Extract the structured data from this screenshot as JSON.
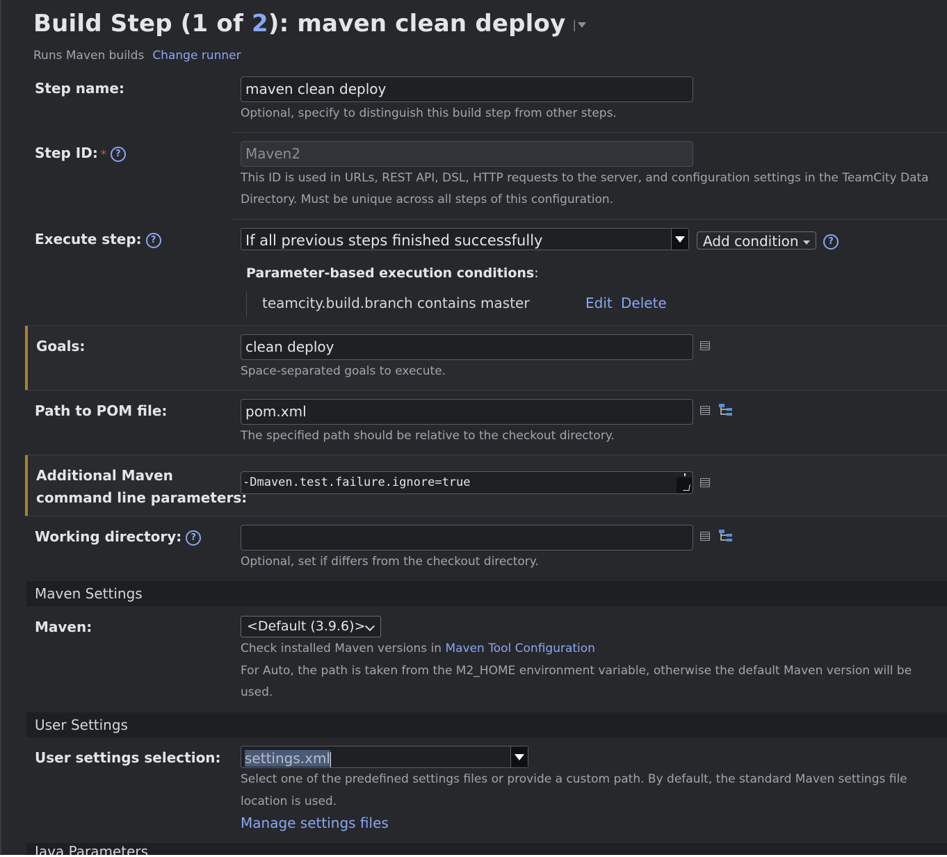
{
  "header": {
    "title_prefix": "Build Step (1 of ",
    "title_total": "2",
    "title_suffix": "): maven clean deploy",
    "runner_text": "Runs Maven builds",
    "change_runner_link": "Change runner"
  },
  "step_name": {
    "label": "Step name:",
    "value": "maven clean deploy",
    "hint": "Optional, specify to distinguish this build step from other steps."
  },
  "step_id": {
    "label": "Step ID:",
    "required_mark": "*",
    "value": "Maven2",
    "hint_line1": "This ID is used in URLs, REST API, DSL, HTTP requests to the server, and configuration settings in the TeamCity Data",
    "hint_line2": "Directory. Must be unique across all steps of this configuration."
  },
  "execute_step": {
    "label": "Execute step:",
    "selected": "If all previous steps finished successfully",
    "add_condition": "Add condition",
    "conditions_title": "Parameter-based execution conditions",
    "conditions_colon": ":",
    "condition_text": "teamcity.build.branch contains master",
    "edit_link": "Edit",
    "delete_link": "Delete"
  },
  "goals": {
    "label": "Goals:",
    "value": "clean deploy",
    "hint": "Space-separated goals to execute."
  },
  "pom": {
    "label": "Path to POM file:",
    "value": "pom.xml",
    "hint": "The specified path should be relative to the checkout directory."
  },
  "additional_params": {
    "label_line1": "Additional Maven",
    "label_line2": "command line parameters:",
    "value": "-Dmaven.test.failure.ignore=true"
  },
  "working_dir": {
    "label": "Working directory:",
    "value": "",
    "hint": "Optional, set if differs from the checkout directory."
  },
  "maven_settings": {
    "section_title": "Maven Settings",
    "label": "Maven:",
    "selected": "<Default (3.9.6)>",
    "hint_prefix": "Check installed Maven versions in ",
    "hint_link": "Maven Tool Configuration",
    "auto_line1": "For Auto, the path is taken from the M2_HOME environment variable, otherwise the default Maven version will be",
    "auto_line2": "used."
  },
  "user_settings": {
    "section_title": "User Settings",
    "label": "User settings selection:",
    "value": "settings.xml",
    "hint_line1": "Select one of the predefined settings files or provide a custom path. By default, the standard Maven settings file",
    "hint_line2": "location is used.",
    "manage_link": "Manage settings files"
  },
  "next_section": {
    "title": "Java Parameters"
  },
  "colors": {
    "background": "#27282c",
    "link": "#8aa7f2",
    "modified_marker": "#a8842c",
    "required": "#e05555"
  }
}
